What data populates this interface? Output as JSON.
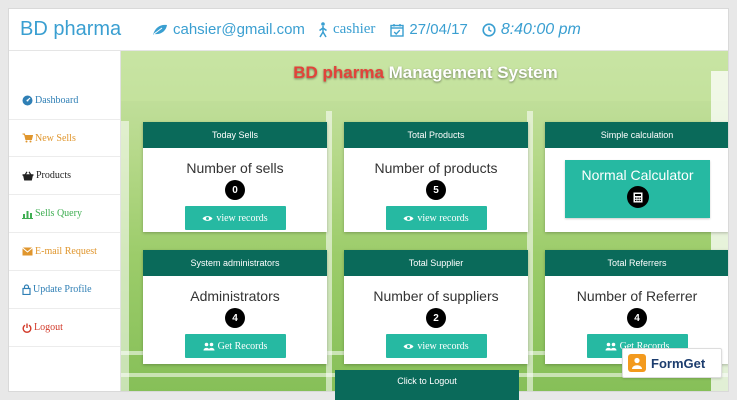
{
  "header": {
    "brand": "BD pharma",
    "email": "cahsier@gmail.com",
    "role": "cashier",
    "date": "27/04/17",
    "time": "8:40:00 pm"
  },
  "sidebar": {
    "items": [
      {
        "label": "Dashboard",
        "icon": "dashboard-icon",
        "color": "#2f7fb5"
      },
      {
        "label": "New Sells",
        "icon": "cart-icon",
        "color": "#e0962d"
      },
      {
        "label": "Products",
        "icon": "basket-icon",
        "color": "#222222"
      },
      {
        "label": "Sells Query",
        "icon": "bar-chart-icon",
        "color": "#3fae52"
      },
      {
        "label": "E-mail Request",
        "icon": "envelope-icon",
        "color": "#e0962d"
      },
      {
        "label": "Update Profile",
        "icon": "lock-icon",
        "color": "#2f7fb5"
      },
      {
        "label": "Logout",
        "icon": "power-icon",
        "color": "#d23b2b"
      }
    ]
  },
  "main": {
    "title_part1": "BD pharma",
    "title_part2": "Management System",
    "cards": [
      {
        "header": "Today Sells",
        "label": "Number of sells",
        "count": "0",
        "button": "view records"
      },
      {
        "header": "Total Products",
        "label": "Number of products",
        "count": "5",
        "button": "view records"
      },
      {
        "header": "Simple calculation",
        "label": "Normal Calculator"
      },
      {
        "header": "System administrators",
        "label": "Administrators",
        "count": "4",
        "button": "Get Records"
      },
      {
        "header": "Total Supplier",
        "label": "Number of suppliers",
        "count": "2",
        "button": "view records"
      },
      {
        "header": "Total Referrers",
        "label": "Number of Referrer",
        "count": "4",
        "button": "Get Records"
      }
    ],
    "logout_card": "Click to Logout"
  },
  "watermark": "FormGet",
  "colors": {
    "accent_blue": "#3a9fd1",
    "card_header": "#0a6a5a",
    "button_teal": "#26b9a2",
    "title_red": "#e2433a"
  }
}
